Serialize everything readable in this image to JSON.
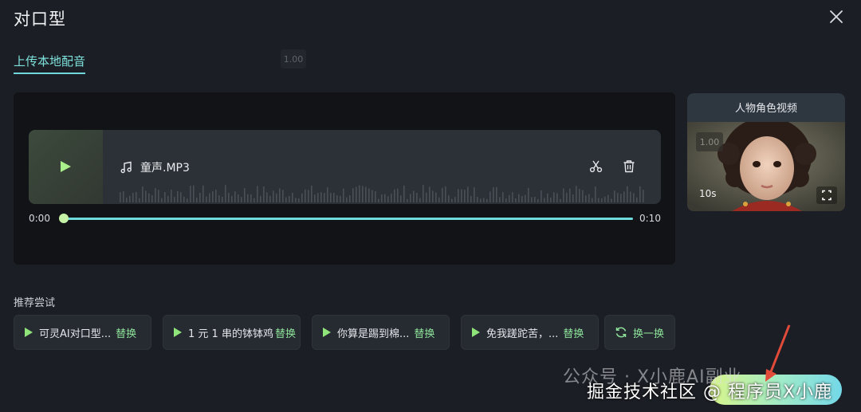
{
  "window": {
    "title": "对口型",
    "close_icon": "close-icon"
  },
  "tab": {
    "label": "上传本地配音"
  },
  "zoom_badge": "1.00",
  "audio": {
    "file_name": "童声.MP3",
    "time_start": "0:00",
    "time_end": "0:10",
    "progress": 0.0,
    "icons": [
      "play-icon",
      "music-note-icon",
      "scissors-icon",
      "trash-icon"
    ]
  },
  "video_card": {
    "title": "人物角色视频",
    "badge": "1.00",
    "duration": "10s"
  },
  "recommend": {
    "label": "推荐尝试",
    "items": [
      {
        "text": "可灵AI对口型...",
        "action": "替换"
      },
      {
        "text": "1 元 1 串的钵钵鸡",
        "action": "替换"
      },
      {
        "text": "你算是踢到棉...",
        "action": "替换"
      },
      {
        "text": "免我蹉跎苦，...",
        "action": "替换"
      }
    ],
    "refresh_label": "换一换"
  },
  "watermark": {
    "line1": "公众号 · X小鹿AI副业",
    "line2": "掘金技术社区 @ 程序员X小鹿"
  },
  "colors": {
    "background": "#1b1e24",
    "accent_teal": "#6fd6d9",
    "accent_green": "#8fe57a",
    "panel": "#111317"
  }
}
